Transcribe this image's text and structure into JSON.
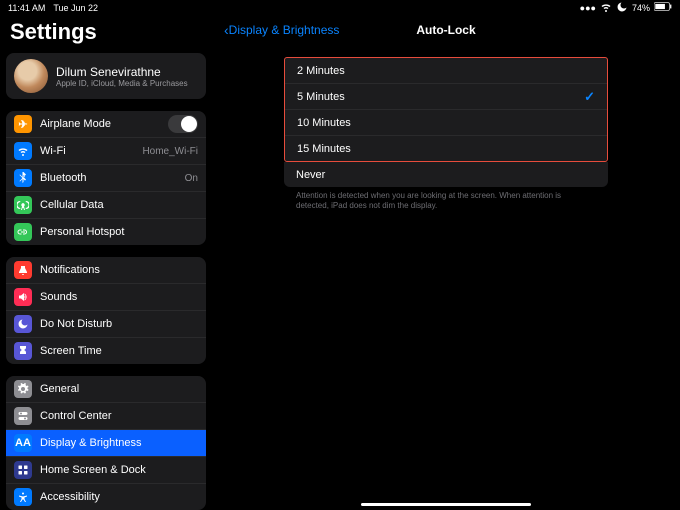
{
  "status": {
    "time": "11:41 AM",
    "date": "Tue Jun 22",
    "battery": "74%"
  },
  "sidebar": {
    "title": "Settings",
    "profile": {
      "name": "Dilum Senevirathne",
      "sub": "Apple ID, iCloud, Media & Purchases"
    },
    "g1": [
      {
        "icon": "✈",
        "bg": "#ff9500",
        "label": "Airplane Mode",
        "toggle": true
      },
      {
        "icon": "wifi",
        "bg": "#007aff",
        "label": "Wi-Fi",
        "value": "Home_Wi-Fi"
      },
      {
        "icon": "bt",
        "bg": "#007aff",
        "label": "Bluetooth",
        "value": "On"
      },
      {
        "icon": "ant",
        "bg": "#34c759",
        "label": "Cellular Data"
      },
      {
        "icon": "link",
        "bg": "#34c759",
        "label": "Personal Hotspot"
      }
    ],
    "g2": [
      {
        "icon": "bell",
        "bg": "#ff3b30",
        "label": "Notifications"
      },
      {
        "icon": "snd",
        "bg": "#ff2d55",
        "label": "Sounds"
      },
      {
        "icon": "moon",
        "bg": "#5856d6",
        "label": "Do Not Disturb"
      },
      {
        "icon": "hg",
        "bg": "#5856d6",
        "label": "Screen Time"
      }
    ],
    "g3": [
      {
        "icon": "gear",
        "bg": "#8e8e93",
        "label": "General"
      },
      {
        "icon": "cc",
        "bg": "#8e8e93",
        "label": "Control Center"
      },
      {
        "icon": "AA",
        "bg": "#007aff",
        "label": "Display & Brightness",
        "selected": true
      },
      {
        "icon": "grid",
        "bg": "#2f3a8f",
        "label": "Home Screen & Dock"
      },
      {
        "icon": "acc",
        "bg": "#007aff",
        "label": "Accessibility"
      }
    ]
  },
  "detail": {
    "back": "Display & Brightness",
    "title": "Auto-Lock",
    "options": [
      {
        "label": "2 Minutes"
      },
      {
        "label": "5 Minutes",
        "checked": true
      },
      {
        "label": "10 Minutes"
      },
      {
        "label": "15 Minutes"
      }
    ],
    "never": "Never",
    "footer": "Attention is detected when you are looking at the screen. When attention is detected, iPad does not dim the display."
  }
}
